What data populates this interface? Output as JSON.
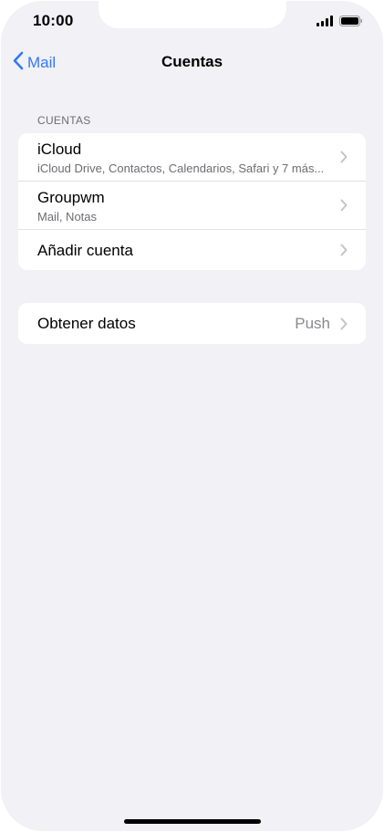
{
  "status_bar": {
    "time": "10:00",
    "icons": [
      "signal-icon",
      "battery-icon"
    ]
  },
  "nav": {
    "back_label": "Mail",
    "title": "Cuentas"
  },
  "accounts_section": {
    "header": "CUENTAS",
    "rows": [
      {
        "title": "iCloud",
        "subtitle": "iCloud Drive, Contactos, Calendarios, Safari y 7 más..."
      },
      {
        "title": "Groupwm",
        "subtitle": "Mail, Notas"
      },
      {
        "title": "Añadir cuenta"
      }
    ]
  },
  "fetch_section": {
    "title": "Obtener datos",
    "value": "Push"
  },
  "colors": {
    "accent": "#3478f6",
    "background": "#f1f1f6",
    "secondary_text": "#6d6d72",
    "chevron": "#c4c4c7"
  }
}
